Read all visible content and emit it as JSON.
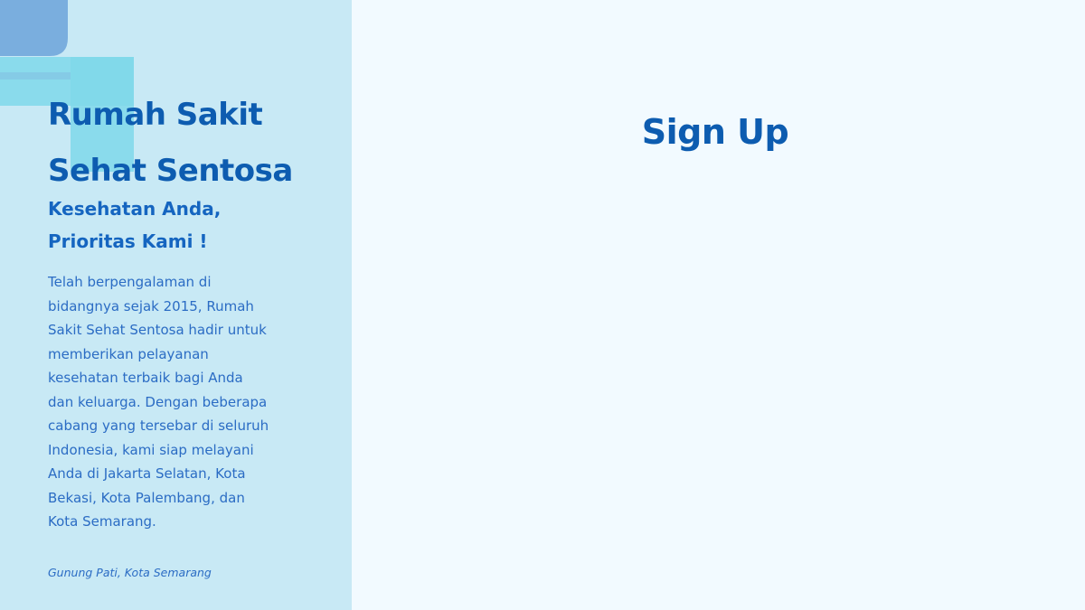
{
  "left_panel": {
    "title_lines": [
      "Rumah Sakit",
      "Sehat Sentosa"
    ],
    "tagline_lines": [
      "Kesehatan Anda,",
      "Prioritas Kami !"
    ],
    "about_lines": [
      "Telah berpengalaman di",
      "bidangnya sejak 2015, Rumah",
      "Sakit Sehat Sentosa hadir untuk",
      "memberikan pelayanan",
      "kesehatan terbaik bagi Anda",
      "dan keluarga. Dengan beberapa",
      "cabang yang tersebar di seluruh",
      "Indonesia, kami siap melayani",
      "Anda di Jakarta Selatan, Kota",
      "Bekasi, Kota Palembang, dan",
      "Kota Semarang."
    ],
    "location": "Gunung Pati, Kota Semarang"
  },
  "right_panel": {
    "heading": "Sign Up"
  },
  "colors": {
    "left_bg": "#c8e9f5",
    "right_bg": "#f2faff",
    "primary_text": "#0d5cb0",
    "body_text": "#2b6cc4",
    "deco_dark": "#7aaede",
    "deco_light": "#7fd8ea"
  },
  "icons": {
    "decoration": "medical-cross-shape"
  }
}
